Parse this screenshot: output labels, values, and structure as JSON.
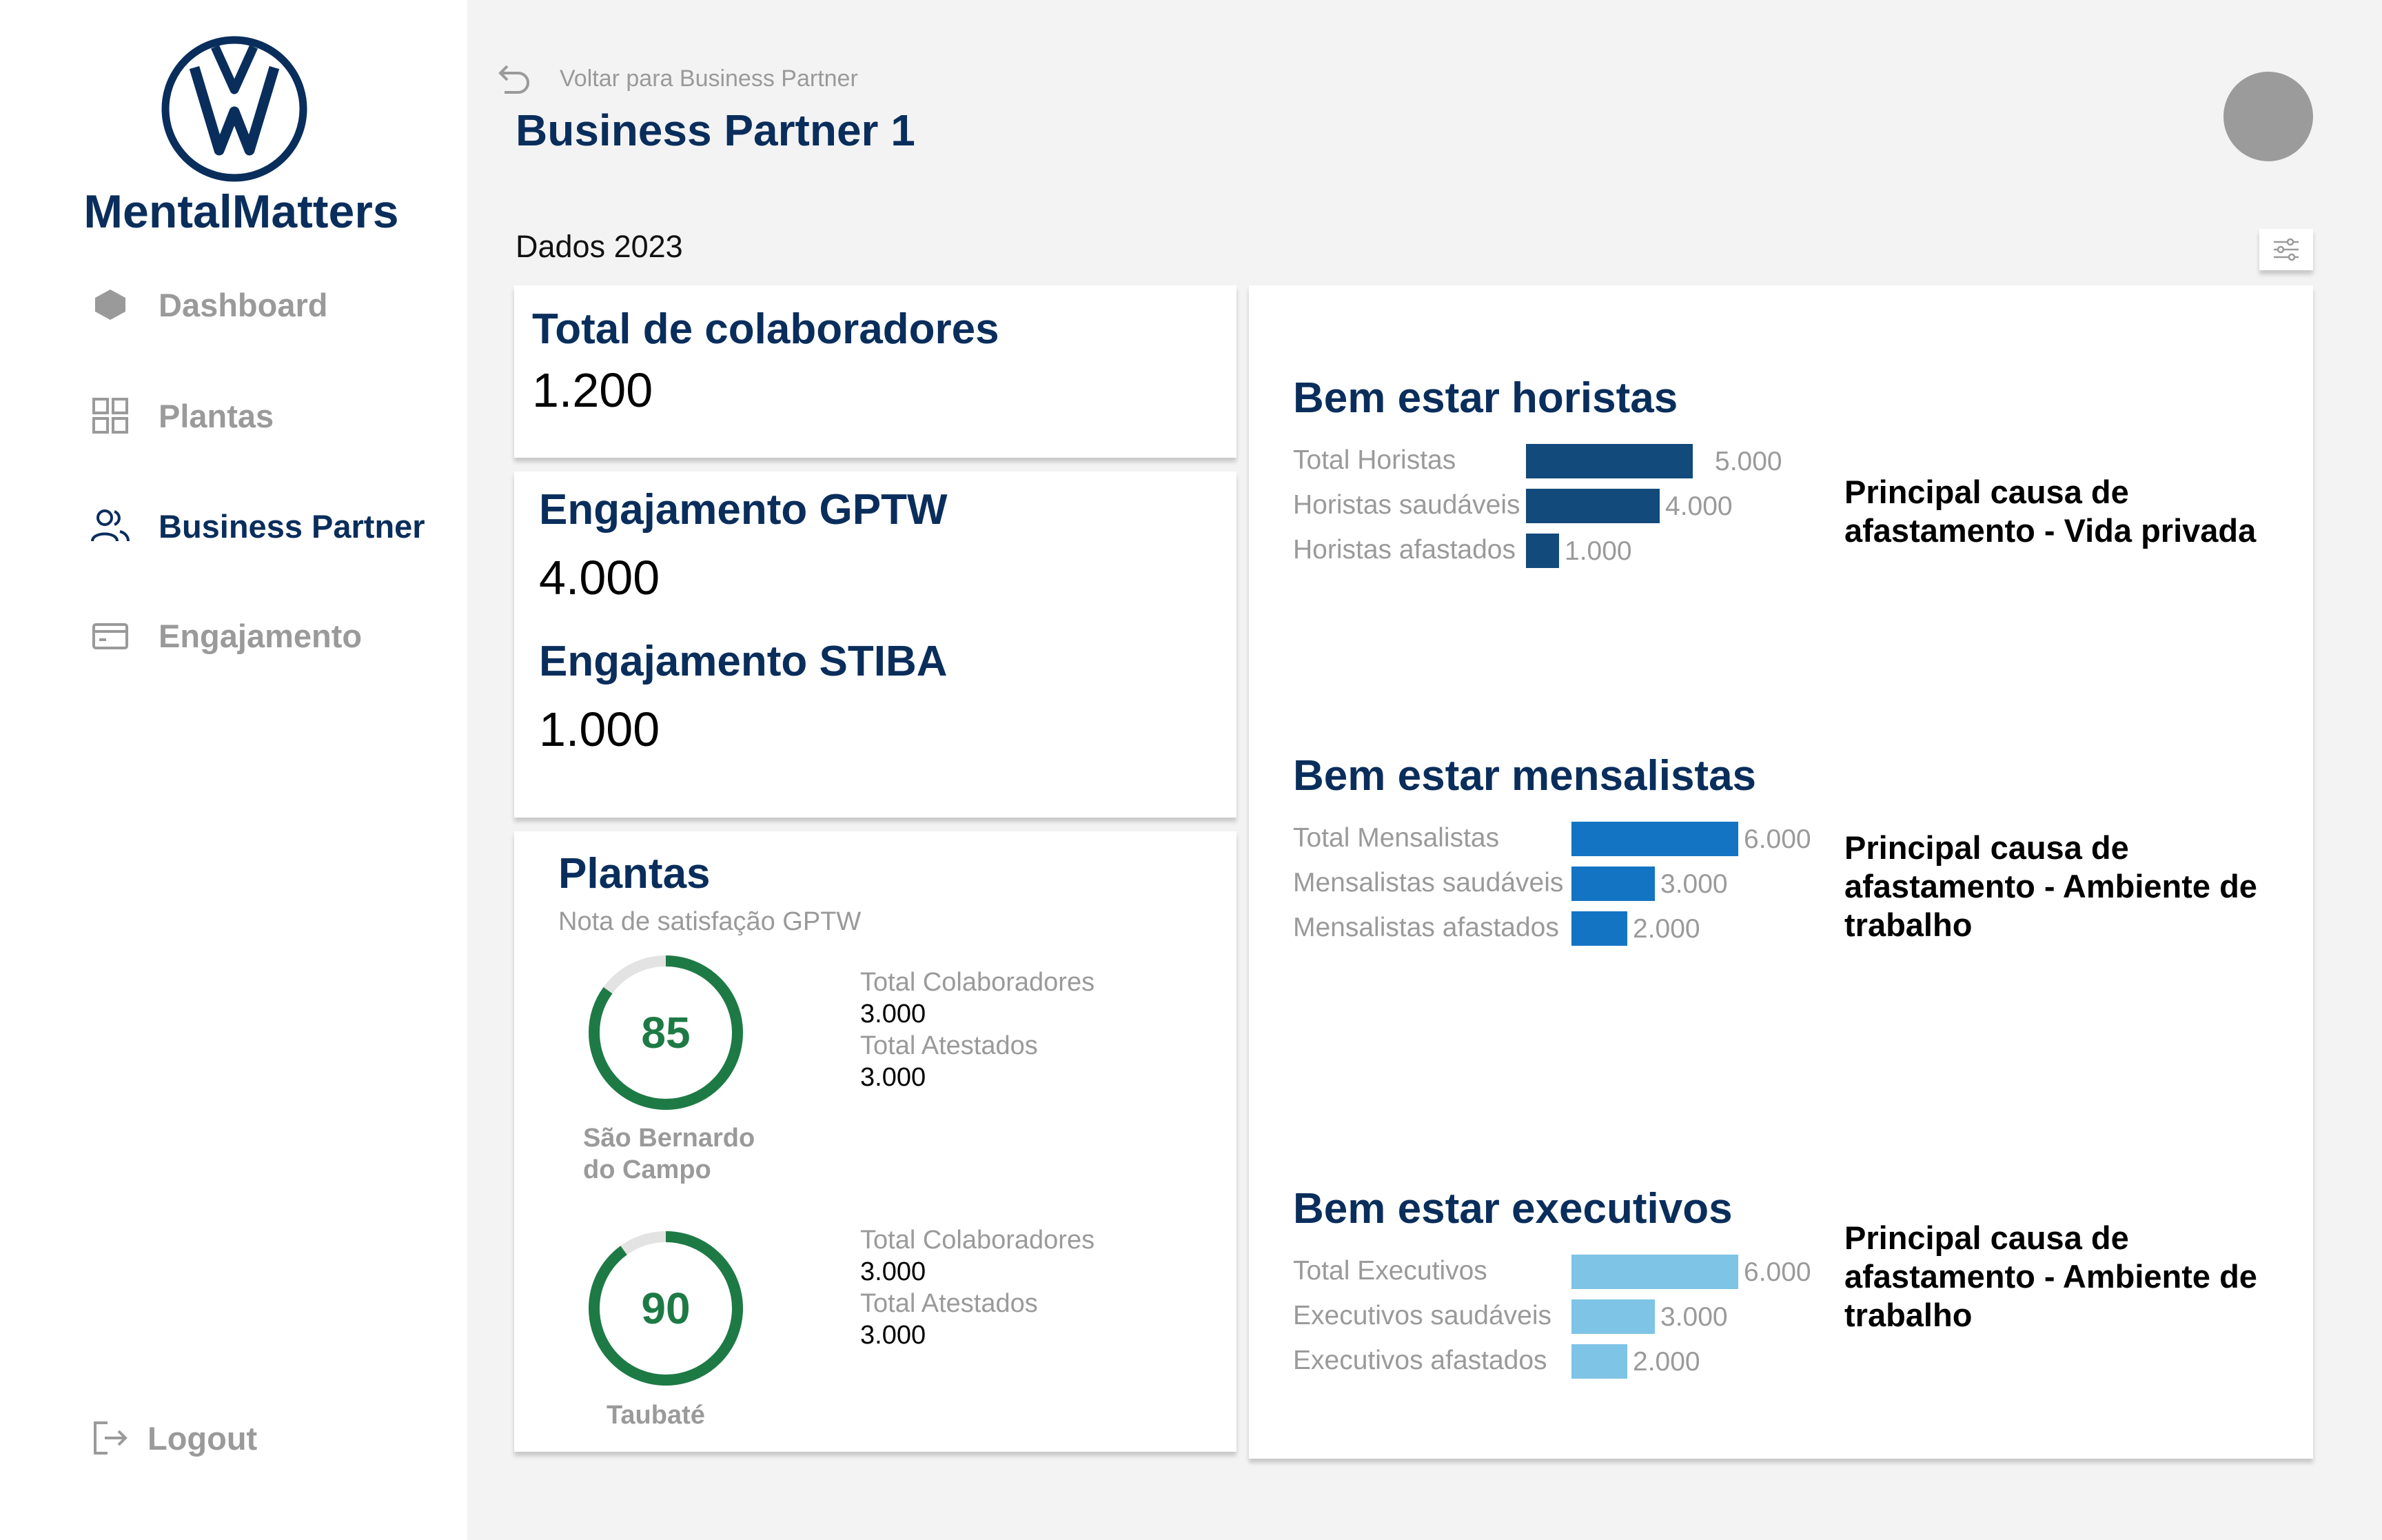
{
  "brand": {
    "name": "MentalMatters"
  },
  "nav": {
    "items": [
      {
        "label": "Dashboard"
      },
      {
        "label": "Plantas"
      },
      {
        "label": "Business Partner"
      },
      {
        "label": "Engajamento"
      }
    ],
    "logout": "Logout"
  },
  "header": {
    "back_link": "Voltar para Business Partner",
    "title": "Business Partner 1",
    "section": "Dados 2023"
  },
  "summary": {
    "total_label": "Total de colaboradores",
    "total_value": "1.200",
    "gptw_label": "Engajamento GPTW",
    "gptw_value": "4.000",
    "stiba_label": "Engajamento STIBA",
    "stiba_value": "1.000"
  },
  "plantas": {
    "title": "Plantas",
    "subtitle": "Nota de satisfação GPTW",
    "items": [
      {
        "score": "85",
        "score_value": 85,
        "name_line1": "São Bernardo",
        "name_line2": "do Campo",
        "colab_label": "Total Colaboradores",
        "colab_value": "3.000",
        "atest_label": "Total Atestados",
        "atest_value": "3.000"
      },
      {
        "score": "90",
        "score_value": 90,
        "name_line1": "Taubaté",
        "name_line2": "",
        "colab_label": "Total Colaboradores",
        "colab_value": "3.000",
        "atest_label": "Total Atestados",
        "atest_value": "3.000"
      }
    ]
  },
  "wellbeing": [
    {
      "title": "Bem estar horistas",
      "color": "#124a7c",
      "max": 5000,
      "rows": [
        {
          "label": "Total Horistas",
          "value": 5000,
          "display": "5.000"
        },
        {
          "label": "Horistas saudáveis",
          "value": 4000,
          "display": "4.000"
        },
        {
          "label": "Horistas afastados",
          "value": 1000,
          "display": "1.000"
        }
      ],
      "cause_line1": "Principal causa de",
      "cause_line2": "afastamento  - Vida privada",
      "cause_line3": ""
    },
    {
      "title": "Bem estar mensalistas",
      "color": "#1474c4",
      "max": 6000,
      "rows": [
        {
          "label": "Total Mensalistas",
          "value": 6000,
          "display": "6.000"
        },
        {
          "label": "Mensalistas saudáveis",
          "value": 3000,
          "display": "3.000"
        },
        {
          "label": "Mensalistas afastados",
          "value": 2000,
          "display": "2.000"
        }
      ],
      "cause_line1": "Principal causa de",
      "cause_line2": "afastamento  - Ambiente de",
      "cause_line3": "trabalho"
    },
    {
      "title": "Bem estar executivos",
      "color": "#7ec4e6",
      "max": 6000,
      "rows": [
        {
          "label": "Total Executivos",
          "value": 6000,
          "display": "6.000"
        },
        {
          "label": "Executivos saudáveis",
          "value": 3000,
          "display": "3.000"
        },
        {
          "label": "Executivos afastados",
          "value": 2000,
          "display": "2.000"
        }
      ],
      "cause_line1": "Principal causa de",
      "cause_line2": "afastamento  - Ambiente de",
      "cause_line3": "trabalho"
    }
  ],
  "colors": {
    "primary": "#0a2e5c",
    "gauge": "#1e7a45",
    "gauge_track": "#e3e3e3"
  }
}
